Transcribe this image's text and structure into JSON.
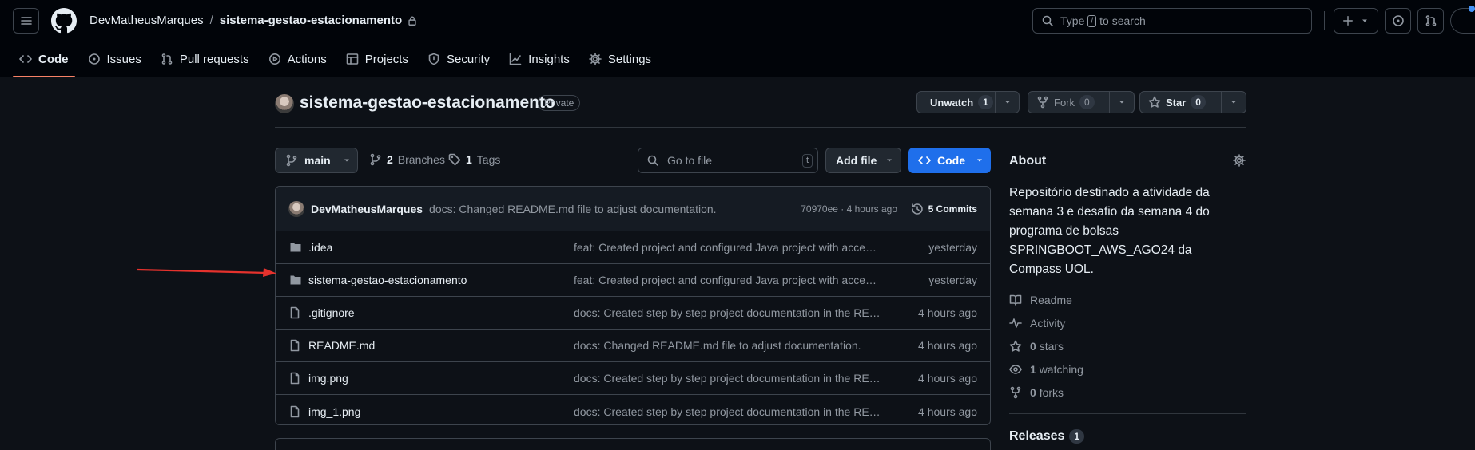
{
  "header": {
    "owner": "DevMatheusMarques",
    "separator": "/",
    "repo": "sistema-gestao-estacionamento",
    "search_before": "Type",
    "search_key": "/",
    "search_after": "to search"
  },
  "tabs": [
    {
      "label": "Code",
      "icon": "code-icon",
      "selected": true
    },
    {
      "label": "Issues",
      "icon": "issue-icon"
    },
    {
      "label": "Pull requests",
      "icon": "git-pull-request-icon"
    },
    {
      "label": "Actions",
      "icon": "play-icon"
    },
    {
      "label": "Projects",
      "icon": "table-icon"
    },
    {
      "label": "Security",
      "icon": "shield-icon"
    },
    {
      "label": "Insights",
      "icon": "graph-icon"
    },
    {
      "label": "Settings",
      "icon": "gear-icon"
    }
  ],
  "repo": {
    "name": "sistema-gestao-estacionamento",
    "visibility": "Private",
    "unwatch_label": "Unwatch",
    "watch_count": "1",
    "fork_label": "Fork",
    "fork_count": "0",
    "star_label": "Star",
    "star_count": "0"
  },
  "toolbar": {
    "branch": "main",
    "branches_count": "2",
    "branches_label": "Branches",
    "tags_count": "1",
    "tags_label": "Tags",
    "goto_placeholder": "Go to file",
    "goto_key": "t",
    "add_file": "Add file",
    "code": "Code"
  },
  "commit": {
    "author": "DevMatheusMarques",
    "message": "docs: Changed README.md file to adjust documentation.",
    "meta": "70970ee · 4 hours ago",
    "commits_label": "5 Commits"
  },
  "files": [
    {
      "type": "dir",
      "name": ".idea",
      "message": "feat: Created project and configured Java project with access control",
      "date": "yesterday"
    },
    {
      "type": "dir",
      "name": "sistema-gestao-estacionamento",
      "message": "feat: Created project and configured Java project with access control",
      "date": "yesterday"
    },
    {
      "type": "file",
      "name": ".gitignore",
      "message": "docs: Created step by step project documentation in the README file",
      "date": "4 hours ago"
    },
    {
      "type": "file",
      "name": "README.md",
      "message": "docs: Changed README.md file to adjust documentation.",
      "date": "4 hours ago"
    },
    {
      "type": "file",
      "name": "img.png",
      "message": "docs: Created step by step project documentation in the README file",
      "date": "4 hours ago"
    },
    {
      "type": "file",
      "name": "img_1.png",
      "message": "docs: Created step by step project documentation in the README file",
      "date": "4 hours ago"
    }
  ],
  "about": {
    "title": "About",
    "description": "Repositório destinado a atividade da semana 3 e desafio da semana 4 do programa de bolsas SPRINGBOOT_AWS_AGO24 da Compass UOL.",
    "readme": "Readme",
    "activity": "Activity",
    "stars_count": "0",
    "stars_label": "stars",
    "watching_count": "1",
    "watching_label": "watching",
    "forks_count": "0",
    "forks_label": "forks",
    "releases_title": "Releases",
    "releases_count": "1"
  },
  "colors": {
    "background": "#0d1117",
    "header_bg": "#010409",
    "accent_blue": "#1f6feb",
    "tab_underline": "#f78166",
    "annotation_arrow": "#e5322d"
  }
}
